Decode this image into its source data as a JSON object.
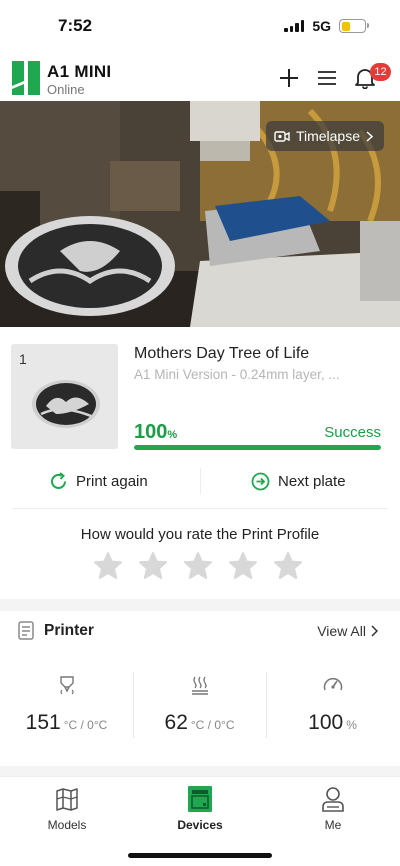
{
  "status_bar": {
    "time": "7:52",
    "network": "5G"
  },
  "header": {
    "device_name": "A1 MINI",
    "device_status": "Online",
    "notification_count": "12",
    "brand_color": "#1fa84f"
  },
  "camera": {
    "timelapse_label": "Timelapse"
  },
  "job": {
    "plate_number": "1",
    "title": "Mothers Day Tree of Life",
    "subtitle": "A1 Mini Version - 0.24mm layer, ...",
    "percent": "100",
    "percent_unit": "%",
    "progress": 1.0,
    "state": "Success"
  },
  "actions": {
    "print_again": "Print again",
    "next_plate": "Next plate"
  },
  "rating": {
    "question": "How would you rate the Print Profile",
    "stars_max": 5,
    "stars_selected": 0
  },
  "printer": {
    "title": "Printer",
    "view_all": "View All",
    "nozzle": {
      "value": "151",
      "unit": "°C / 0°C"
    },
    "bed": {
      "value": "62",
      "unit": "°C / 0°C"
    },
    "speed": {
      "value": "100",
      "unit": "%"
    }
  },
  "tabs": [
    {
      "label": "Models",
      "icon": "models-icon",
      "active": false
    },
    {
      "label": "Devices",
      "icon": "devices-icon",
      "active": true
    },
    {
      "label": "Me",
      "icon": "profile-icon",
      "active": false
    }
  ]
}
